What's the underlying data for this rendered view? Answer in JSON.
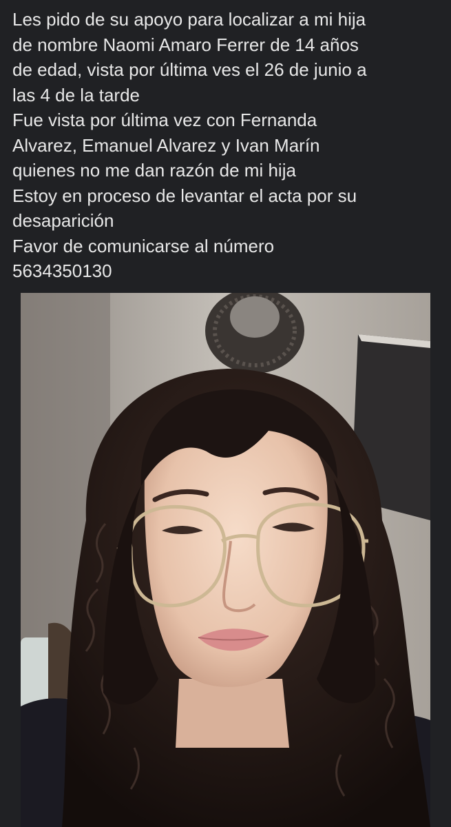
{
  "post": {
    "text_lines": [
      "Les pido de su apoyo para localizar a mi hija",
      "de nombre Naomi Amaro Ferrer de 14 años",
      "de edad, vista por última ves el 26 de junio a",
      "las 4 de la tarde",
      "Fue vista por última vez con Fernanda",
      "Alvarez, Emanuel Alvarez y Ivan Marín",
      "quienes no me dan razón de mi hija",
      "Estoy en proceso de levantar el acta por su",
      "desaparición",
      "Favor de comunicarse al número",
      "5634350130"
    ]
  },
  "photo": {
    "subject": "selfie of a girl with curly dark hair and round glasses"
  },
  "colors": {
    "background": "#202124",
    "text": "#e8e8e8"
  }
}
